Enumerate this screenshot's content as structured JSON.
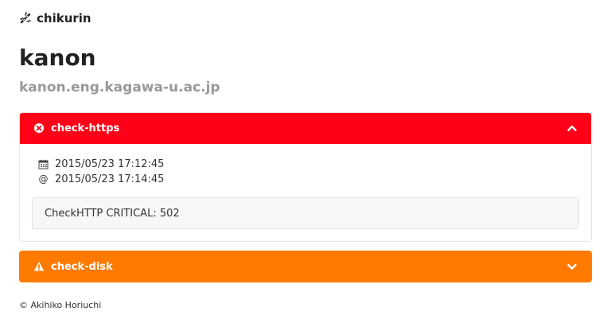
{
  "brand": {
    "name": "chikurin",
    "logo_icon": "bamboo-icon"
  },
  "host": {
    "name": "kanon",
    "fqdn": "kanon.eng.kagawa-u.ac.jp"
  },
  "checks": [
    {
      "name": "check-https",
      "status": "critical",
      "status_icon": "x-circle-icon",
      "color": "#ff0018",
      "expanded": true,
      "detected_at": "2015/05/23 17:12:45",
      "updated_at": "2015/05/23 17:14:45",
      "output": "CheckHTTP CRITICAL: 502"
    },
    {
      "name": "check-disk",
      "status": "warning",
      "status_icon": "warning-triangle-icon",
      "color": "#ff7a00",
      "expanded": false
    }
  ],
  "footer": {
    "text": "© Akihiko Horiuchi"
  }
}
